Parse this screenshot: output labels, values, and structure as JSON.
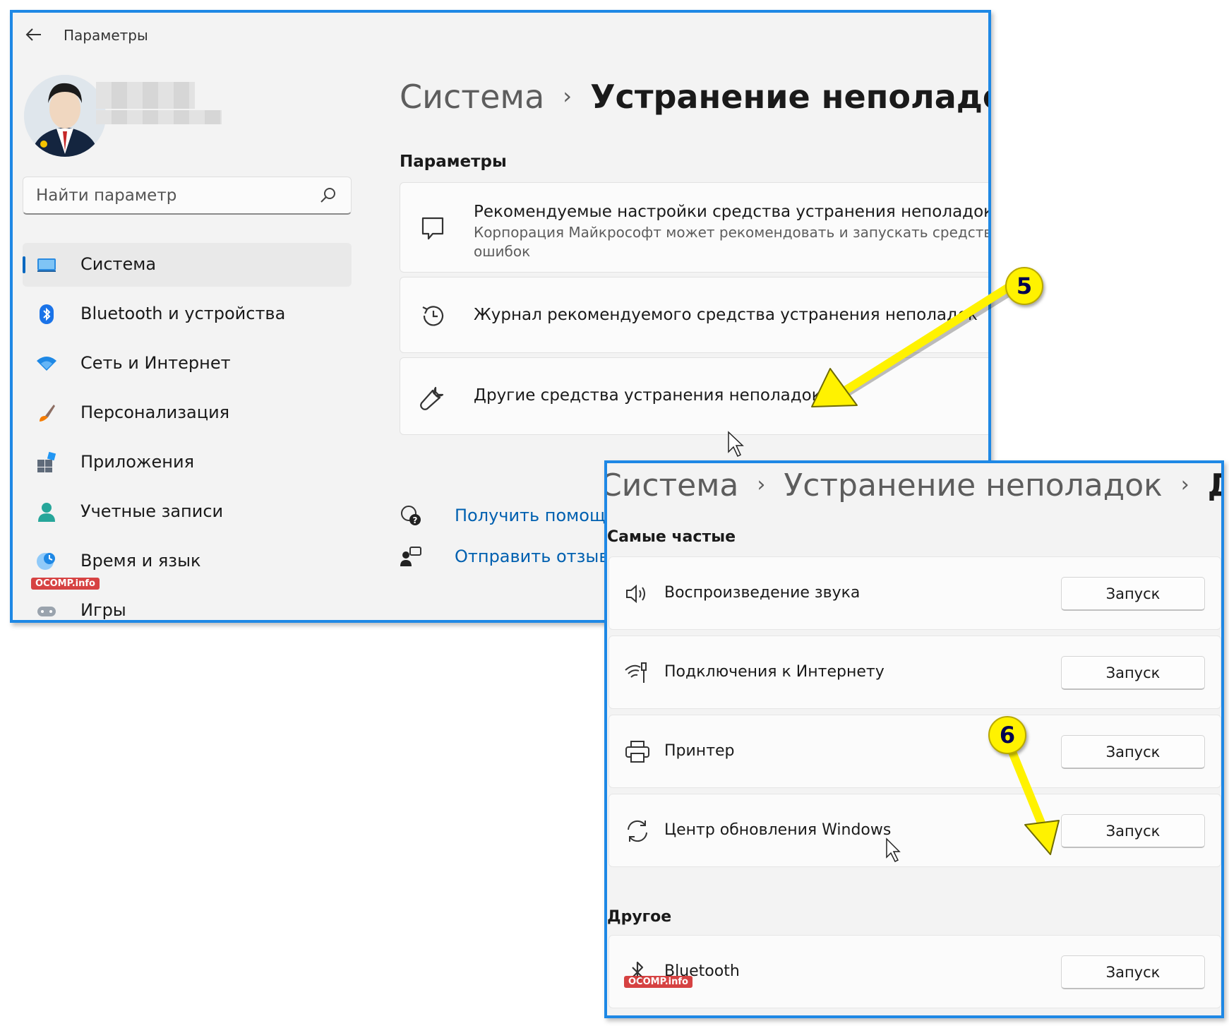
{
  "window1": {
    "app_title": "Параметры",
    "search": {
      "placeholder": "Найти параметр"
    },
    "nav": [
      {
        "label": "Система",
        "icon": "display-icon",
        "active": true
      },
      {
        "label": "Bluetooth и устройства",
        "icon": "bluetooth-icon"
      },
      {
        "label": "Сеть и Интернет",
        "icon": "wifi-icon"
      },
      {
        "label": "Персонализация",
        "icon": "brush-icon"
      },
      {
        "label": "Приложения",
        "icon": "apps-icon"
      },
      {
        "label": "Учетные записи",
        "icon": "person-icon"
      },
      {
        "label": "Время и язык",
        "icon": "globe-clock-icon"
      },
      {
        "label": "Игры",
        "icon": "gamepad-icon"
      }
    ],
    "breadcrumb": {
      "parent": "Система",
      "separator": "›",
      "current": "Устранение неполадок"
    },
    "section_label": "Параметры",
    "cards": [
      {
        "title": "Рекомендуемые настройки средства устранения неполадок",
        "desc_line1": "Корпорация Майкрософт может рекомендовать и запускать средства уст",
        "desc_line2": "ошибок",
        "icon": "chat-bubble-icon"
      },
      {
        "title": "Журнал рекомендуемого средства устранения неполадок",
        "icon": "history-icon"
      },
      {
        "title": "Другие средства устранения неполадок",
        "icon": "wrench-icon"
      }
    ],
    "help": [
      {
        "label": "Получить помощь",
        "icon": "help-icon"
      },
      {
        "label": "Отправить отзыв",
        "icon": "feedback-icon"
      }
    ]
  },
  "window2": {
    "breadcrumb": {
      "part1": "Система",
      "part2": "Устранение неполадок",
      "part3": "Други",
      "separator": "›"
    },
    "group_frequent": "Самые частые",
    "group_other": "Другое",
    "tools": [
      {
        "label": "Воспроизведение звука",
        "button": "Запуск",
        "icon": "speaker-icon"
      },
      {
        "label": "Подключения к Интернету",
        "button": "Запуск",
        "icon": "wifi-signal-icon"
      },
      {
        "label": "Принтер",
        "button": "Запуск",
        "icon": "printer-icon"
      },
      {
        "label": "Центр обновления Windows",
        "button": "Запуск",
        "icon": "refresh-icon"
      }
    ],
    "other_tools": [
      {
        "label": "Bluetooth",
        "button": "Запуск",
        "icon": "bluetooth-icon"
      }
    ]
  },
  "annotations": {
    "step5": "5",
    "step6": "6",
    "arrow_color": "#fff200"
  },
  "watermark": "OCOMP.info",
  "colors": {
    "accent": "#0067c0",
    "frame": "#1e88e5",
    "link": "#0060b0"
  }
}
